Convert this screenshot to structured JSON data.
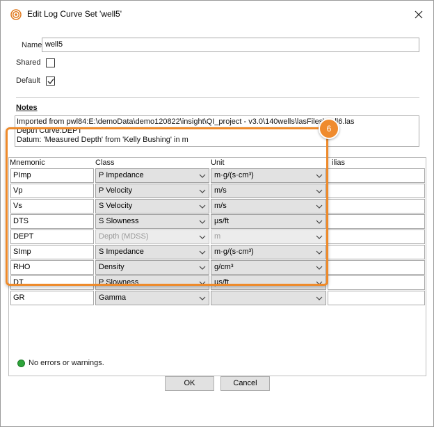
{
  "window": {
    "title": "Edit Log Curve Set 'well5'"
  },
  "form": {
    "name_label": "Name",
    "name_value": "well5",
    "shared_label": "Shared",
    "shared_checked": false,
    "default_label": "Default",
    "default_checked": true
  },
  "notes": {
    "title": "Notes",
    "lines": [
      "Imported from pwl84:E:\\demoData\\demo120822\\insight\\QI_project - v3.0\\140wells\\lasFiles\\well6.las",
      "Depth Curve:DEPT",
      "Datum: 'Measured Depth' from 'Kelly Bushing' in m"
    ]
  },
  "table": {
    "headers": {
      "mnemonic": "Mnemonic",
      "class": "Class",
      "unit": "Unit",
      "aliases": "ilias"
    },
    "rows": [
      {
        "mnemonic": "PImp",
        "class": "P Impedance",
        "unit": "m·g/(s·cm³)",
        "alias": "",
        "disabled": false
      },
      {
        "mnemonic": "Vp",
        "class": "P Velocity",
        "unit": "m/s",
        "alias": "",
        "disabled": false
      },
      {
        "mnemonic": "Vs",
        "class": "S Velocity",
        "unit": "m/s",
        "alias": "",
        "disabled": false
      },
      {
        "mnemonic": "DTS",
        "class": "S Slowness",
        "unit": "µs/ft",
        "alias": "",
        "disabled": false
      },
      {
        "mnemonic": "DEPT",
        "class": "Depth (MDSS)",
        "unit": "m",
        "alias": "",
        "disabled": true
      },
      {
        "mnemonic": "SImp",
        "class": "S Impedance",
        "unit": "m·g/(s·cm³)",
        "alias": "",
        "disabled": false
      },
      {
        "mnemonic": "RHO",
        "class": "Density",
        "unit": "g/cm³",
        "alias": "",
        "disabled": false
      },
      {
        "mnemonic": "DT",
        "class": "P Slowness",
        "unit": "µs/ft",
        "alias": "",
        "disabled": false
      },
      {
        "mnemonic": "GR",
        "class": "Gamma",
        "unit": "",
        "alias": "",
        "disabled": false
      }
    ]
  },
  "callout": {
    "number": "6",
    "color": "#ef8b2e"
  },
  "status": {
    "text": "No errors or warnings.",
    "color": "#2ea43a"
  },
  "buttons": {
    "ok": "OK",
    "cancel": "Cancel"
  },
  "icons": {
    "app": "target-icon",
    "close": "close-icon",
    "dropdown": "chevron-down-icon",
    "check": "checkmark-icon"
  }
}
